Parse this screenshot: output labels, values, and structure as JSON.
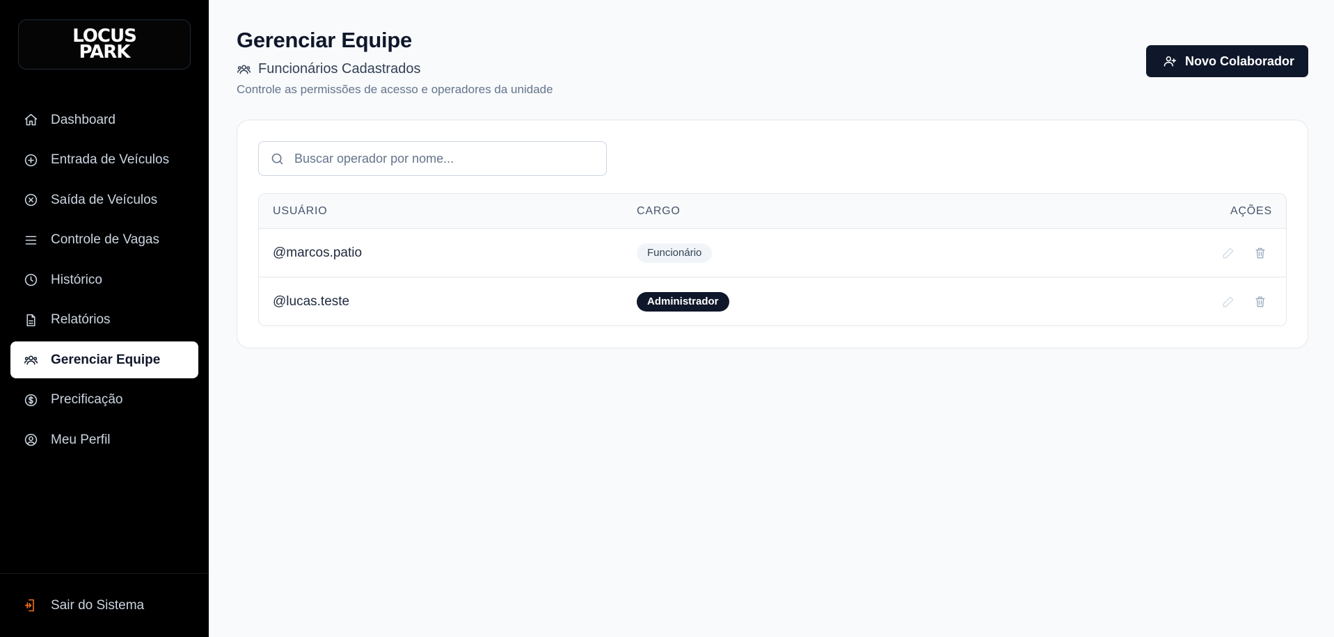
{
  "brand": {
    "line1": "LOCUS",
    "line2": "PARK"
  },
  "sidebar": {
    "items": [
      {
        "label": "Dashboard",
        "icon": "home-icon"
      },
      {
        "label": "Entrada de Veículos",
        "icon": "plus-circle-icon"
      },
      {
        "label": "Saída de Veículos",
        "icon": "x-circle-icon"
      },
      {
        "label": "Controle de Vagas",
        "icon": "menu-icon"
      },
      {
        "label": "Histórico",
        "icon": "clock-icon"
      },
      {
        "label": "Relatórios",
        "icon": "file-icon"
      },
      {
        "label": "Gerenciar Equipe",
        "icon": "users-icon",
        "active": true
      },
      {
        "label": "Precificação",
        "icon": "dollar-circle-icon"
      },
      {
        "label": "Meu Perfil",
        "icon": "user-circle-icon"
      }
    ],
    "logout_label": "Sair do Sistema"
  },
  "header": {
    "title": "Gerenciar Equipe",
    "subtitle": "Funcionários Cadastrados",
    "description": "Controle as permissões de acesso e operadores da unidade",
    "new_button_label": "Novo Colaborador"
  },
  "search": {
    "placeholder": "Buscar operador por nome...",
    "value": ""
  },
  "table": {
    "headers": {
      "user": "USUÁRIO",
      "role": "CARGO",
      "actions": "AÇÕES"
    },
    "rows": [
      {
        "user": "@marcos.patio",
        "role": "Funcionário",
        "role_style": "light"
      },
      {
        "user": "@lucas.teste",
        "role": "Administrador",
        "role_style": "dark"
      }
    ]
  },
  "colors": {
    "accent": "#0f172a",
    "sidebar": "#000000",
    "logout_icon": "#f97316"
  }
}
